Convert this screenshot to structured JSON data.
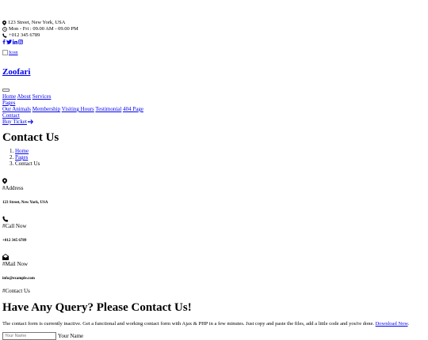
{
  "topbar": {
    "address": "123 Street, New York, USA",
    "hours": "Mon - Fri : 09.00 AM - 09.00 PM",
    "phone": "+012 345 6789"
  },
  "logo_alt": "Icon",
  "brand": "Zoofari",
  "nav": {
    "home": "Home",
    "about": "About",
    "services": "Services",
    "pages": "Pages",
    "dropdown": [
      "Our Animals",
      "Membership",
      "Visiting Hours",
      "Testimonial",
      "404 Page"
    ],
    "contact": "Contact",
    "buy_ticket": "Buy Ticket"
  },
  "page_title": "Contact Us",
  "breadcrumb": [
    "Home",
    "Pages",
    "Contact Us"
  ],
  "info": [
    {
      "icon": "map-marker-icon",
      "label": "#Address",
      "value": "123 Street, New York, USA"
    },
    {
      "icon": "phone-icon",
      "label": "#Call Now",
      "value": "+012 345 6789"
    },
    {
      "icon": "envelope-open-icon",
      "label": "#Mail Now",
      "value": "info@example.com"
    }
  ],
  "section_label": "#Contact Us",
  "heading": "Have Any Query? Please Contact Us!",
  "lead_text": "The contact form is currently inactive. Get a functional and working contact form with Ajax & PHP in a few minutes. Just copy and paste the files, add a little code and you're done.",
  "lead_link": "Download Now",
  "form": {
    "name_placeholder": "Your Name",
    "name_label": "Your Name"
  },
  "colors": {
    "link": "#0000ee",
    "text": "#000000"
  }
}
